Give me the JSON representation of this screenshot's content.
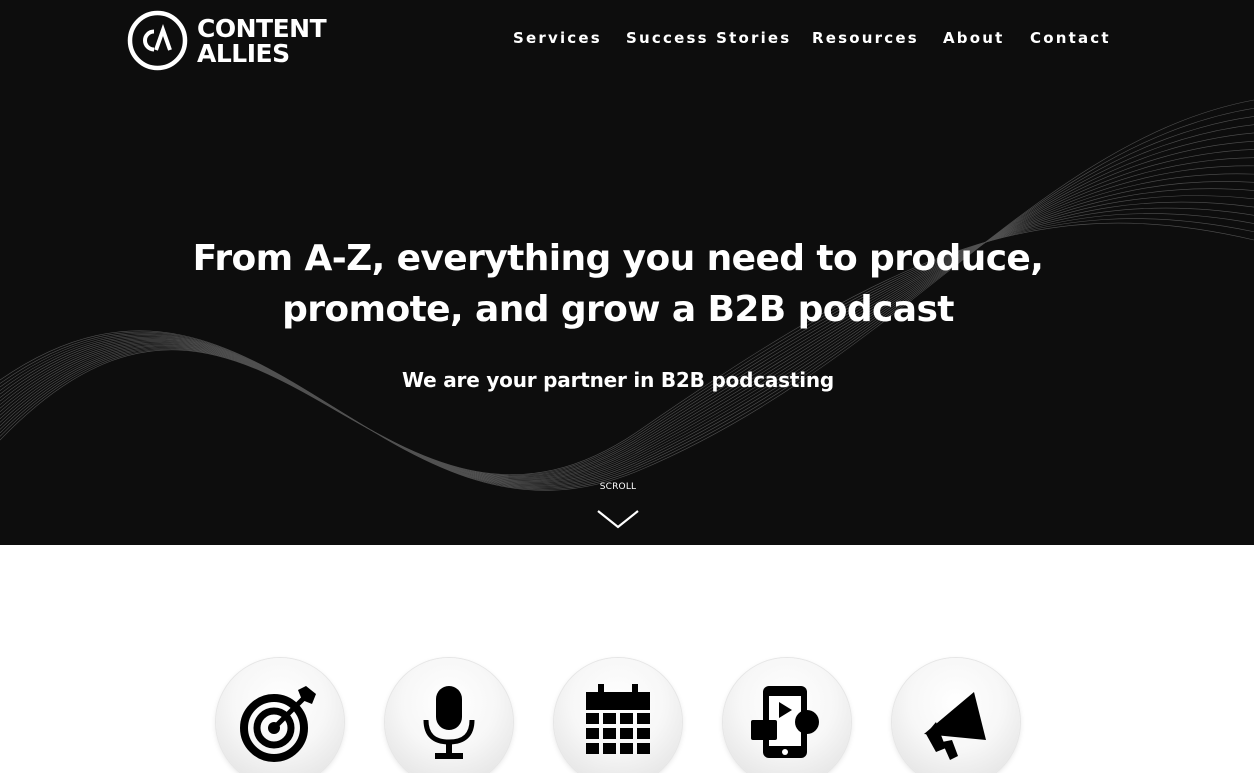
{
  "brand": {
    "logo_line1": "CONTENT",
    "logo_line2": "ALLIES",
    "logo_mark_icon": "ca-circle-logo-icon"
  },
  "nav": {
    "items": [
      {
        "label": "Services"
      },
      {
        "label": "Success Stories"
      },
      {
        "label": "Resources"
      },
      {
        "label": "About"
      },
      {
        "label": "Contact"
      }
    ]
  },
  "hero": {
    "headline_line1": "From A-Z, everything you need to produce,",
    "headline_line2": "promote, and grow a B2B podcast",
    "subheadline": "We are your partner in B2B podcasting",
    "scroll_label": "SCROLL",
    "scroll_icon": "chevron-down-icon"
  },
  "services": {
    "icons": [
      "target-icon",
      "microphone-icon",
      "calendar-icon",
      "mobile-video-chat-icon",
      "megaphone-icon"
    ]
  },
  "colors": {
    "hero_background": "#0d0d0d",
    "text_light": "#ffffff",
    "page_background": "#ffffff",
    "icon_color": "#000000"
  }
}
